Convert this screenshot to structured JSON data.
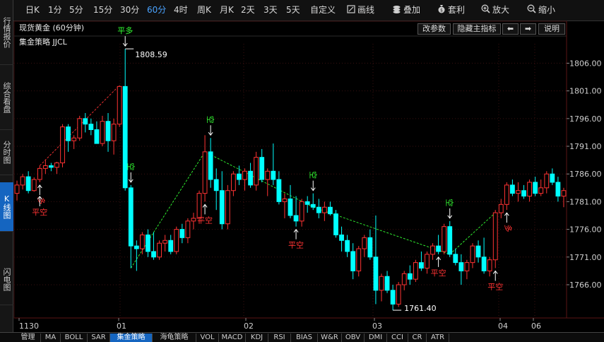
{
  "sidebar": {
    "tabs": [
      {
        "label": "行情报价",
        "active": false
      },
      {
        "label": "综合看盘",
        "active": false
      },
      {
        "label": "分时图",
        "active": false
      },
      {
        "label": "K线图",
        "active": true
      },
      {
        "label": "闪电图",
        "active": false
      }
    ]
  },
  "toolbar": {
    "periods": [
      "日K",
      "1分",
      "5分",
      "15分",
      "30分",
      "60分",
      "4时",
      "周K",
      "月K",
      "2天",
      "3天",
      "5天",
      "自定义"
    ],
    "active_period": "60分",
    "draw_label": "画线",
    "overlay_label": "叠加",
    "arbitrage_label": "套利",
    "zoom_in_label": "放大",
    "zoom_out_label": "缩小"
  },
  "header": {
    "title": "现货黄金 (60分钟)",
    "indicator": "集金策略  JJCL",
    "edit_params_label": "改参数",
    "hide_indicator_label": "隐藏主指标",
    "left_arrow": "⬅",
    "right_arrow": "➡",
    "help_label": "说明"
  },
  "colors": {
    "up": "#ff3333",
    "down": "#00ffff",
    "grid": "#3a1010",
    "signal_up": "#ff3333",
    "signal_down": "#33ff33",
    "arrow": "#ffffff",
    "tab_active": "#1565c0"
  },
  "chart_data": {
    "type": "candlestick",
    "y_ticks": [
      1806.0,
      1801.0,
      1796.0,
      1791.0,
      1786.0,
      1781.0,
      1776.0,
      1771.0,
      1766.0
    ],
    "ylim": [
      1760.0,
      1809.5
    ],
    "x_labels": [
      "1130",
      "01",
      "02",
      "03",
      "04",
      "06"
    ],
    "high_label": "1808.59",
    "low_label": "1761.40",
    "candles": [
      [
        1782.5,
        1784.8,
        1781.2,
        1784.0
      ],
      [
        1784.0,
        1786.0,
        1783.2,
        1785.5
      ],
      [
        1785.5,
        1786.5,
        1782.5,
        1783.0
      ],
      [
        1783.0,
        1785.4,
        1782.8,
        1785.0
      ],
      [
        1785.0,
        1787.5,
        1784.5,
        1787.0
      ],
      [
        1787.0,
        1788.5,
        1786.0,
        1787.5
      ],
      [
        1787.5,
        1788.0,
        1786.5,
        1787.2
      ],
      [
        1787.2,
        1788.2,
        1786.0,
        1788.0
      ],
      [
        1788.0,
        1795.0,
        1787.2,
        1794.5
      ],
      [
        1794.5,
        1795.0,
        1790.0,
        1792.0
      ],
      [
        1792.0,
        1793.0,
        1790.5,
        1792.5
      ],
      [
        1792.5,
        1796.5,
        1792.0,
        1796.0
      ],
      [
        1796.0,
        1797.0,
        1793.5,
        1795.0
      ],
      [
        1795.0,
        1796.0,
        1793.0,
        1794.0
      ],
      [
        1794.0,
        1795.5,
        1791.5,
        1791.5
      ],
      [
        1791.5,
        1796.5,
        1791.0,
        1795.5
      ],
      [
        1795.5,
        1797.0,
        1790.0,
        1792.0
      ],
      [
        1792.0,
        1796.0,
        1789.5,
        1795.0
      ],
      [
        1795.0,
        1802.0,
        1794.5,
        1801.8
      ],
      [
        1801.8,
        1808.59,
        1783.0,
        1783.5
      ],
      [
        1783.5,
        1784.0,
        1769.0,
        1773.0
      ],
      [
        1773.0,
        1774.0,
        1768.5,
        1772.5
      ],
      [
        1772.5,
        1775.5,
        1771.5,
        1775.0
      ],
      [
        1775.0,
        1776.0,
        1771.0,
        1772.0
      ],
      [
        1772.0,
        1775.5,
        1770.5,
        1771.0
      ],
      [
        1771.0,
        1774.0,
        1770.5,
        1773.5
      ],
      [
        1773.5,
        1775.0,
        1772.0,
        1774.0
      ],
      [
        1774.0,
        1775.0,
        1771.5,
        1772.0
      ],
      [
        1772.0,
        1776.5,
        1771.5,
        1776.0
      ],
      [
        1776.0,
        1777.0,
        1773.5,
        1774.5
      ],
      [
        1774.5,
        1778.0,
        1773.5,
        1777.5
      ],
      [
        1777.5,
        1779.0,
        1776.0,
        1778.0
      ],
      [
        1778.0,
        1783.0,
        1777.0,
        1782.5
      ],
      [
        1782.5,
        1793.0,
        1781.0,
        1790.0
      ],
      [
        1790.0,
        1792.5,
        1783.5,
        1785.0
      ],
      [
        1785.0,
        1787.0,
        1779.5,
        1783.0
      ],
      [
        1783.0,
        1786.5,
        1776.0,
        1777.0
      ],
      [
        1777.0,
        1784.0,
        1776.0,
        1783.0
      ],
      [
        1783.0,
        1786.5,
        1782.0,
        1786.0
      ],
      [
        1786.0,
        1787.5,
        1784.0,
        1785.0
      ],
      [
        1785.0,
        1787.0,
        1783.0,
        1786.5
      ],
      [
        1786.5,
        1788.0,
        1783.5,
        1784.0
      ],
      [
        1784.0,
        1790.0,
        1783.0,
        1789.0
      ],
      [
        1789.0,
        1790.5,
        1784.5,
        1785.0
      ],
      [
        1785.0,
        1787.0,
        1782.0,
        1786.5
      ],
      [
        1786.5,
        1791.5,
        1784.0,
        1785.0
      ],
      [
        1785.0,
        1786.5,
        1780.5,
        1781.0
      ],
      [
        1781.0,
        1782.5,
        1778.0,
        1781.5
      ],
      [
        1781.5,
        1784.0,
        1778.0,
        1778.5
      ],
      [
        1778.5,
        1782.0,
        1776.5,
        1777.5
      ],
      [
        1777.5,
        1781.5,
        1776.5,
        1781.0
      ],
      [
        1781.0,
        1782.0,
        1779.0,
        1780.5
      ],
      [
        1780.5,
        1782.5,
        1779.5,
        1780.0
      ],
      [
        1780.0,
        1781.5,
        1778.0,
        1779.0
      ],
      [
        1779.0,
        1781.0,
        1777.5,
        1780.0
      ],
      [
        1780.0,
        1781.0,
        1778.5,
        1778.8
      ],
      [
        1778.8,
        1779.5,
        1774.5,
        1775.0
      ],
      [
        1775.0,
        1776.5,
        1772.0,
        1774.0
      ],
      [
        1774.0,
        1775.0,
        1771.0,
        1772.0
      ],
      [
        1772.0,
        1773.5,
        1767.0,
        1768.5
      ],
      [
        1768.5,
        1773.0,
        1767.5,
        1772.5
      ],
      [
        1772.5,
        1775.0,
        1771.0,
        1774.5
      ],
      [
        1774.5,
        1776.0,
        1770.5,
        1771.0
      ],
      [
        1771.0,
        1778.5,
        1762.5,
        1765.0
      ],
      [
        1765.0,
        1768.0,
        1763.0,
        1767.5
      ],
      [
        1767.5,
        1768.5,
        1764.5,
        1765.0
      ],
      [
        1765.0,
        1766.0,
        1761.4,
        1762.5
      ],
      [
        1762.5,
        1766.5,
        1762.0,
        1766.0
      ],
      [
        1766.0,
        1768.5,
        1765.0,
        1768.0
      ],
      [
        1768.0,
        1769.5,
        1766.0,
        1767.0
      ],
      [
        1767.0,
        1770.5,
        1766.5,
        1770.0
      ],
      [
        1770.0,
        1772.0,
        1768.5,
        1769.0
      ],
      [
        1769.0,
        1772.0,
        1768.0,
        1771.5
      ],
      [
        1771.5,
        1773.5,
        1770.5,
        1773.0
      ],
      [
        1773.0,
        1775.0,
        1771.5,
        1772.0
      ],
      [
        1772.0,
        1777.0,
        1771.5,
        1776.5
      ],
      [
        1776.5,
        1777.5,
        1771.0,
        1771.5
      ],
      [
        1771.5,
        1772.5,
        1769.5,
        1770.0
      ],
      [
        1770.0,
        1771.5,
        1766.0,
        1768.5
      ],
      [
        1768.5,
        1770.5,
        1767.0,
        1770.0
      ],
      [
        1770.0,
        1773.5,
        1769.0,
        1773.0
      ],
      [
        1773.0,
        1774.0,
        1770.0,
        1771.0
      ],
      [
        1771.0,
        1774.5,
        1768.0,
        1768.5
      ],
      [
        1768.5,
        1771.0,
        1767.5,
        1770.5
      ],
      [
        1770.5,
        1779.5,
        1769.0,
        1779.0
      ],
      [
        1779.0,
        1781.5,
        1778.0,
        1780.5
      ],
      [
        1780.5,
        1784.5,
        1779.5,
        1784.0
      ],
      [
        1784.0,
        1785.0,
        1782.0,
        1782.5
      ],
      [
        1782.5,
        1784.5,
        1781.0,
        1783.0
      ],
      [
        1783.0,
        1784.0,
        1781.5,
        1782.0
      ],
      [
        1782.0,
        1785.0,
        1781.0,
        1784.5
      ],
      [
        1784.5,
        1785.5,
        1782.0,
        1782.5
      ],
      [
        1782.5,
        1785.0,
        1782.0,
        1783.5
      ],
      [
        1783.5,
        1786.5,
        1782.5,
        1786.0
      ],
      [
        1786.0,
        1787.0,
        1784.0,
        1784.5
      ],
      [
        1784.5,
        1785.5,
        1781.0,
        1782.0
      ],
      [
        1782.0,
        1783.5,
        1780.0,
        1783.0
      ]
    ],
    "signals": [
      {
        "index": 4,
        "label": "多",
        "type": "long",
        "pos": "below"
      },
      {
        "index": 4,
        "label": "平空",
        "type": "close-short",
        "pos": "below"
      },
      {
        "index": 19,
        "label": "平多",
        "type": "close-long",
        "pos": "above"
      },
      {
        "index": 20,
        "label": "空",
        "type": "short",
        "pos": "above"
      },
      {
        "index": 34,
        "label": "空",
        "type": "short",
        "pos": "above"
      },
      {
        "index": 33,
        "label": "平空",
        "type": "close-short",
        "pos": "below"
      },
      {
        "index": 52,
        "label": "空",
        "type": "short",
        "pos": "above"
      },
      {
        "index": 49,
        "label": "平空",
        "type": "close-short",
        "pos": "below"
      },
      {
        "index": 76,
        "label": "空",
        "type": "short",
        "pos": "above"
      },
      {
        "index": 74,
        "label": "平空",
        "type": "close-short",
        "pos": "below"
      },
      {
        "index": 84,
        "label": "平空",
        "type": "close-short",
        "pos": "below"
      },
      {
        "index": 86,
        "label": "多",
        "type": "long",
        "pos": "below"
      }
    ]
  },
  "bottom_tabs": [
    {
      "label": "管理",
      "active": false
    },
    {
      "label": "MA",
      "active": false
    },
    {
      "label": "BOLL",
      "active": false
    },
    {
      "label": "SAR",
      "active": false
    },
    {
      "label": "集金策略",
      "active": true
    },
    {
      "label": "海龟策略",
      "active": false
    },
    {
      "label": "VOL",
      "active": false
    },
    {
      "label": "MACD",
      "active": false
    },
    {
      "label": "KDJ",
      "active": false
    },
    {
      "label": "RSI",
      "active": false
    },
    {
      "label": "BIAS",
      "active": false
    },
    {
      "label": "W&R",
      "active": false
    },
    {
      "label": "OBV",
      "active": false
    },
    {
      "label": "DMI",
      "active": false
    },
    {
      "label": "CCI",
      "active": false
    },
    {
      "label": "CR",
      "active": false
    },
    {
      "label": "ATR",
      "active": false
    }
  ]
}
